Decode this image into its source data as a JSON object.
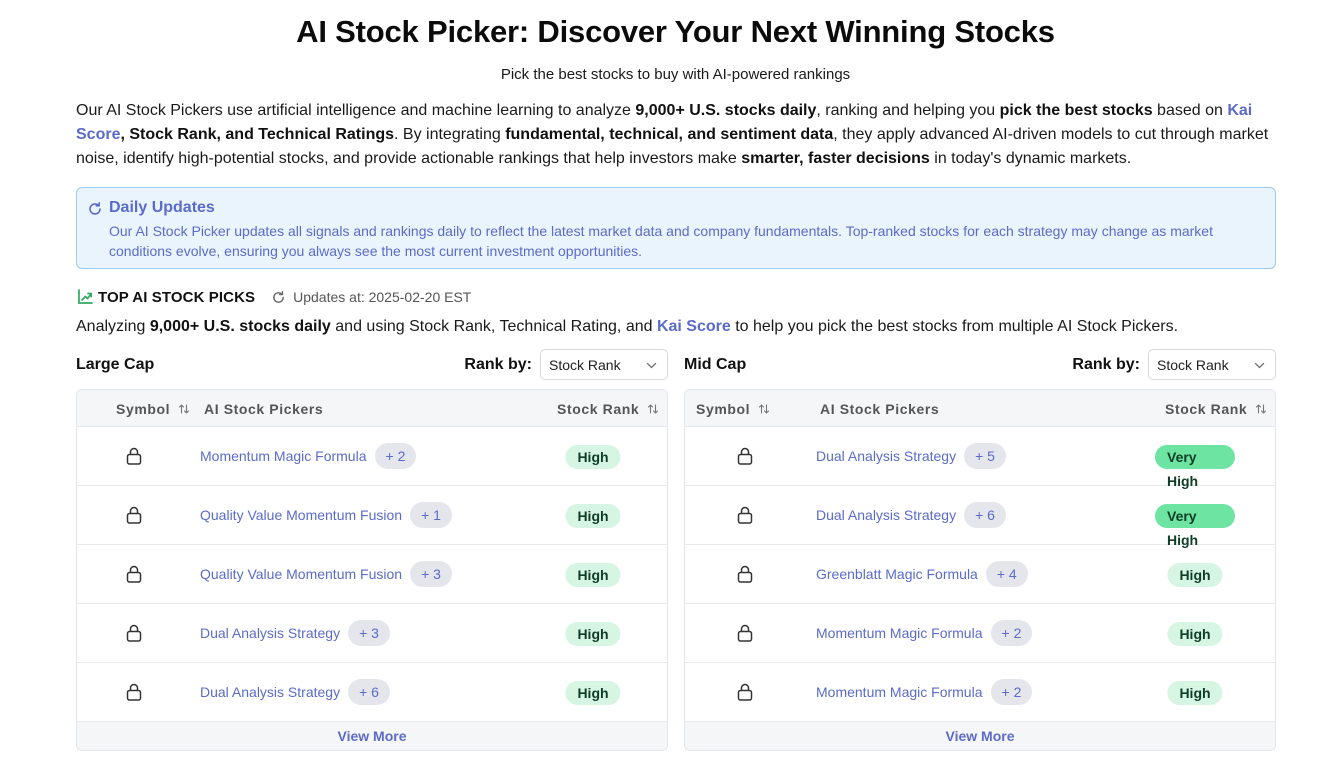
{
  "header": {
    "title": "AI Stock Picker: Discover Your Next Winning Stocks",
    "subtitle": "Pick the best stocks to buy with AI-powered rankings"
  },
  "intro": {
    "p1": "Our AI Stock Pickers use artificial intelligence and machine learning to analyze ",
    "b1": "9,000+ U.S. stocks daily",
    "p2": ", ranking and helping you ",
    "b2": "pick the best stocks",
    "p3": " based on ",
    "link": "Kai Score",
    "p4": ", ",
    "b3": "Stock Rank, and Technical Ratings",
    "p5": ". By integrating ",
    "b4": "fundamental, technical, and sentiment data",
    "p6": ", they apply advanced AI-driven models to cut through market noise, identify high-potential stocks, and provide actionable rankings that help investors make ",
    "b5": "smarter, faster decisions",
    "p7": " in today's dynamic markets."
  },
  "notice": {
    "icon": "refresh-icon",
    "title": "Daily Updates",
    "body": "Our AI Stock Picker updates all signals and rankings daily to reflect the latest market data and company fundamentals. Top-ranked stocks for each strategy may change as market conditions evolve, ensuring you always see the most current investment opportunities."
  },
  "picks": {
    "icon": "trending-up-icon",
    "title": "TOP AI STOCK PICKS",
    "updated": "Updates at: 2025-02-20 EST",
    "analyzing_p1": "Analyzing ",
    "analyzing_b1": "9,000+ U.S. stocks daily",
    "analyzing_p2": " and using Stock Rank, Technical Rating, and ",
    "analyzing_link": "Kai Score",
    "analyzing_p3": " to help you pick the best stocks from multiple AI Stock Pickers."
  },
  "columns": {
    "symbol": "Symbol",
    "pickers": "AI Stock Pickers",
    "rank": "Stock Rank"
  },
  "rank_by_label": "Rank by:",
  "view_more": "View More",
  "colors": {
    "accent": "#5b6bc9",
    "high_badge": "#d6f5e3",
    "very_high_badge": "#6ee4a3",
    "notice_bg": "#eaf4fc",
    "notice_border": "#9ecbe8"
  },
  "large_cap": {
    "title": "Large Cap",
    "rank_by": "Stock Rank",
    "rows": [
      {
        "picker": "Momentum Magic Formula",
        "more": "+ 2",
        "rank": "High"
      },
      {
        "picker": "Quality Value Momentum Fusion",
        "more": "+ 1",
        "rank": "High"
      },
      {
        "picker": "Quality Value Momentum Fusion",
        "more": "+ 3",
        "rank": "High"
      },
      {
        "picker": "Dual Analysis Strategy",
        "more": "+ 3",
        "rank": "High"
      },
      {
        "picker": "Dual Analysis Strategy",
        "more": "+ 6",
        "rank": "High"
      }
    ]
  },
  "mid_cap": {
    "title": "Mid Cap",
    "rank_by": "Stock Rank",
    "rows": [
      {
        "picker": "Dual Analysis Strategy",
        "more": "+ 5",
        "rank": "Very High"
      },
      {
        "picker": "Dual Analysis Strategy",
        "more": "+ 6",
        "rank": "Very High"
      },
      {
        "picker": "Greenblatt Magic Formula",
        "more": "+ 4",
        "rank": "High"
      },
      {
        "picker": "Momentum Magic Formula",
        "more": "+ 2",
        "rank": "High"
      },
      {
        "picker": "Momentum Magic Formula",
        "more": "+ 2",
        "rank": "High"
      }
    ]
  }
}
